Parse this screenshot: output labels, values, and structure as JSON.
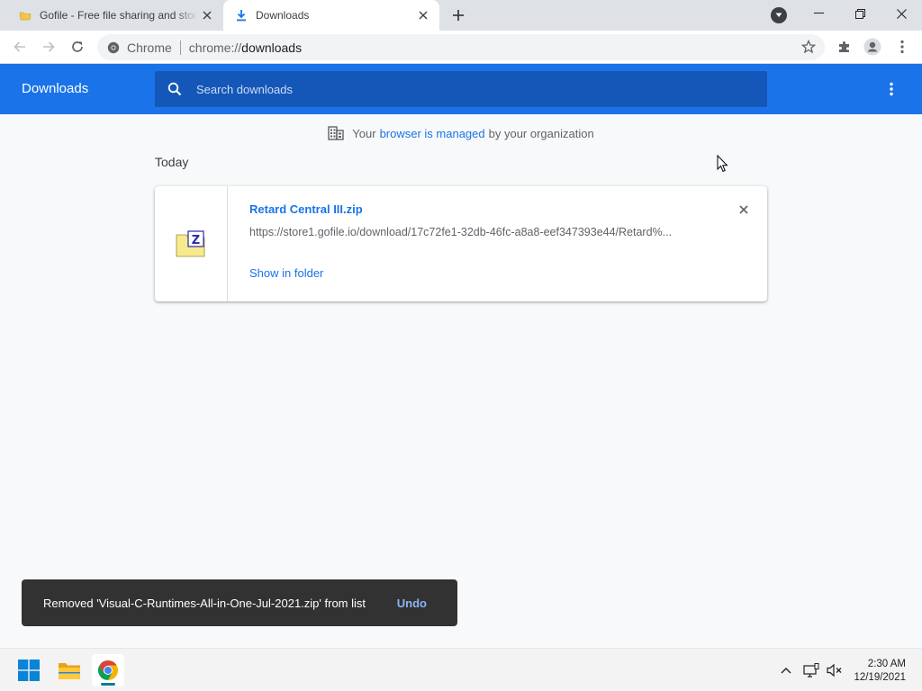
{
  "tabs": [
    {
      "title": "Gofile - Free file sharing and storage",
      "icon": "folder-favicon",
      "active": false
    },
    {
      "title": "Downloads",
      "icon": "download-favicon",
      "active": true
    }
  ],
  "omnibox": {
    "chip_label": "Chrome",
    "url_scheme": "chrome://",
    "url_host": "downloads"
  },
  "downloads_page": {
    "title": "Downloads",
    "search_placeholder": "Search downloads"
  },
  "managed_notice": {
    "prefix": "Your",
    "link": "browser is managed",
    "suffix": "by your organization"
  },
  "section_label": "Today",
  "download_item": {
    "filename": "Retard Central III.zip",
    "url": "https://store1.gofile.io/download/17c72fe1-32db-46fc-a8a8-eef347393e44/Retard%...",
    "show_in_folder": "Show in folder",
    "file_icon": "zip-file-icon"
  },
  "toast": {
    "message": "Removed 'Visual-C-Runtimes-All-in-One-Jul-2021.zip' from list",
    "action": "Undo"
  },
  "taskbar": {
    "apps": [
      "start",
      "file-explorer",
      "chrome"
    ],
    "time": "2:30 AM",
    "date": "12/19/2021"
  },
  "colors": {
    "accent": "#1a73e8",
    "header_search_bg": "#1557b9",
    "toast_bg": "#323232",
    "toast_action": "#8ab4f8"
  }
}
